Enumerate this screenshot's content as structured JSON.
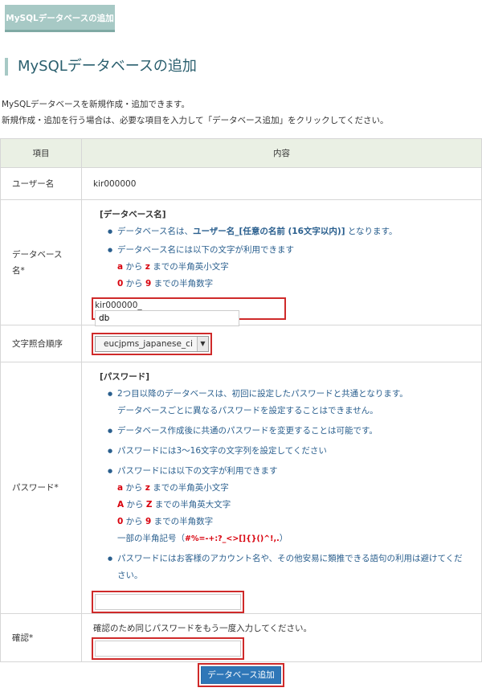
{
  "tab": {
    "label": "MySQLデータベースの追加"
  },
  "page": {
    "title": "MySQLデータベースの追加"
  },
  "intro": {
    "line1": "MySQLデータベースを新規作成・追加できます。",
    "line2": "新規作成・追加を行う場合は、必要な項目を入力して「データベース追加」をクリックしてください。"
  },
  "table": {
    "header_item": "項目",
    "header_content": "内容",
    "user": {
      "label": "ユーザー名",
      "value": "kir000000"
    },
    "dbname": {
      "label": "データベース名*",
      "heading": "[データベース名]",
      "note1_pre": "データベース名は、",
      "note1_bold": "ユーザー名_[任意の名前 (16文字以内)]",
      "note1_post": " となります。",
      "note2": "データベース名には以下の文字が利用できます",
      "range1_a": "a",
      "range1_mid": " から ",
      "range1_b": "z",
      "range1_post": " までの半角英小文字",
      "range2_a": "0",
      "range2_mid": " から ",
      "range2_b": "9",
      "range2_post": " までの半角数字",
      "prefix": "kir000000_",
      "input_value": "db"
    },
    "collation": {
      "label": "文字照合順序",
      "selected": "eucjpms_japanese_ci"
    },
    "password": {
      "label": "パスワード*",
      "heading": "[パスワード]",
      "note1a": "2つ目以降のデータベースは、初回に設定したパスワードと共通となります。",
      "note1b": "データベースごとに異なるパスワードを設定することはできません。",
      "note2": "データベース作成後に共通のパスワードを変更することは可能です。",
      "note3": "パスワードには3～16文字の文字列を設定してください",
      "note4": "パスワードには以下の文字が利用できます",
      "r1_a": "a",
      "r1_mid": " から ",
      "r1_b": "z",
      "r1_post": " までの半角英小文字",
      "r2_a": "A",
      "r2_mid": " から ",
      "r2_b": "Z",
      "r2_post": " までの半角英大文字",
      "r3_a": "0",
      "r3_mid": " から ",
      "r3_b": "9",
      "r3_post": " までの半角数字",
      "symbols_pre": "一部の半角記号（",
      "symbols": "#%=-+:?_<>[]{}()^!,.",
      "symbols_post": "）",
      "note5": "パスワードにはお客様のアカウント名や、その他安易に類推できる語句の利用は避けてください。",
      "input_value": ""
    },
    "confirm": {
      "label": "確認*",
      "text": "確認のため同じパスワードをもう一度入力してください。",
      "input_value": ""
    }
  },
  "submit": {
    "label": "データベース追加"
  }
}
